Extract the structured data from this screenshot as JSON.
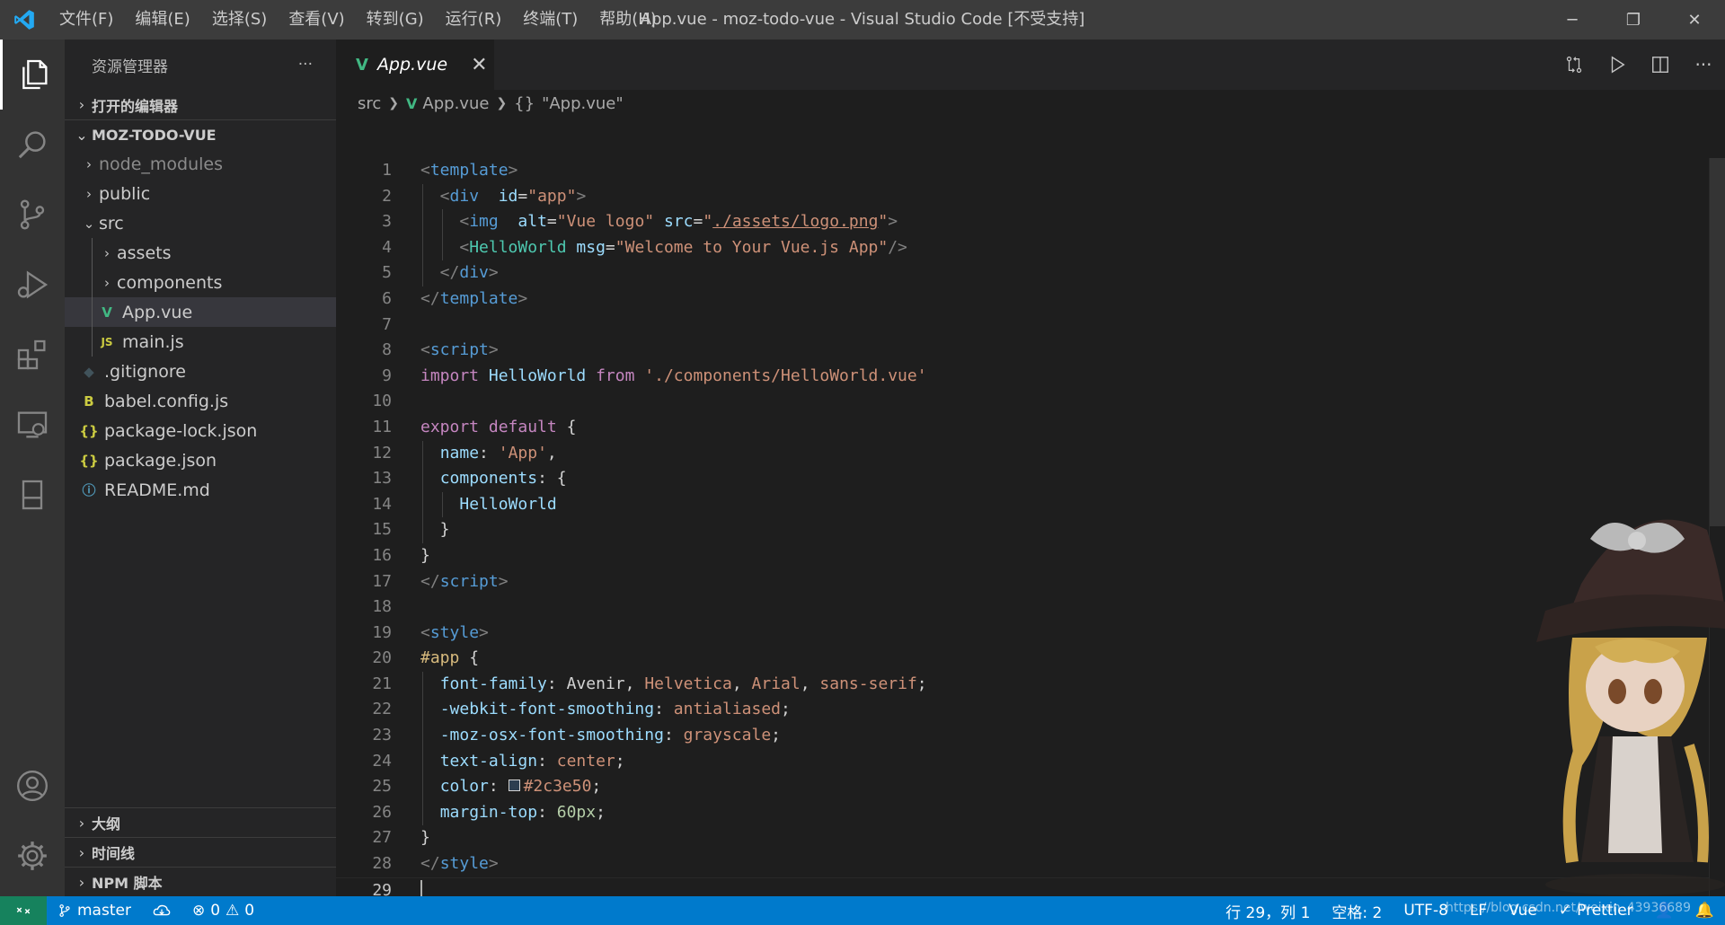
{
  "window": {
    "title": "App.vue - moz-todo-vue - Visual Studio Code [不受支持]",
    "menu": [
      "文件(F)",
      "编辑(E)",
      "选择(S)",
      "查看(V)",
      "转到(G)",
      "运行(R)",
      "终端(T)",
      "帮助(H)"
    ],
    "controls": {
      "minimize": "─",
      "restore": "❐",
      "close": "✕"
    }
  },
  "activity_bar": {
    "items": [
      "files-icon",
      "search-icon",
      "source-control-icon",
      "run-debug-icon",
      "extensions-icon",
      "remote-explorer-icon",
      "bookmark-icon"
    ],
    "bottom": [
      "account-icon",
      "settings-gear-icon"
    ],
    "active": "files-icon"
  },
  "sidebar": {
    "title": "资源管理器",
    "more": "···",
    "open_editors": "打开的编辑器",
    "project": "MOZ-TODO-VUE",
    "tree": [
      {
        "label": "node_modules",
        "type": "folder",
        "expanded": false,
        "depth": 1,
        "dim": true
      },
      {
        "label": "public",
        "type": "folder",
        "expanded": false,
        "depth": 1
      },
      {
        "label": "src",
        "type": "folder",
        "expanded": true,
        "depth": 1
      },
      {
        "label": "assets",
        "type": "folder",
        "expanded": false,
        "depth": 2
      },
      {
        "label": "components",
        "type": "folder",
        "expanded": false,
        "depth": 2
      },
      {
        "label": "App.vue",
        "type": "vue",
        "depth": 2,
        "selected": true
      },
      {
        "label": "main.js",
        "type": "js",
        "depth": 2
      },
      {
        "label": ".gitignore",
        "type": "git",
        "depth": 1
      },
      {
        "label": "babel.config.js",
        "type": "babel",
        "depth": 1
      },
      {
        "label": "package-lock.json",
        "type": "json",
        "depth": 1
      },
      {
        "label": "package.json",
        "type": "json",
        "depth": 1
      },
      {
        "label": "README.md",
        "type": "info",
        "depth": 1
      }
    ],
    "bottom_sections": [
      "大纲",
      "时间线",
      "NPM 脚本"
    ]
  },
  "editor": {
    "tab": {
      "label": "App.vue",
      "close": "✕"
    },
    "breadcrumb": {
      "folder": "src",
      "file": "App.vue",
      "symbol": "\"App.vue\"",
      "symbol_icon": "{}"
    },
    "current_line": 29,
    "lines": [
      [
        [
          "t-tag",
          "<"
        ],
        [
          "t-tagn",
          "template"
        ],
        [
          "t-tag",
          ">"
        ]
      ],
      [
        [
          "t-tag",
          "  <"
        ],
        [
          "t-tagn",
          "div"
        ],
        [
          "",
          "  "
        ],
        [
          "t-attr",
          "id"
        ],
        [
          "",
          "="
        ],
        [
          "t-str",
          "\"app\""
        ],
        [
          "t-tag",
          ">"
        ]
      ],
      [
        [
          "t-tag",
          "    <"
        ],
        [
          "t-tagn",
          "img"
        ],
        [
          "",
          "  "
        ],
        [
          "t-attr",
          "alt"
        ],
        [
          "",
          "="
        ],
        [
          "t-str",
          "\"Vue logo\""
        ],
        [
          "",
          " "
        ],
        [
          "t-attr",
          "src"
        ],
        [
          "",
          "="
        ],
        [
          "t-str",
          "\""
        ],
        [
          "t-str t-link",
          "./assets/logo.png"
        ],
        [
          "t-str",
          "\""
        ],
        [
          "t-tag",
          ">"
        ]
      ],
      [
        [
          "t-tag",
          "    <"
        ],
        [
          "t-comp",
          "HelloWorld"
        ],
        [
          "",
          " "
        ],
        [
          "t-attr",
          "msg"
        ],
        [
          "",
          "="
        ],
        [
          "t-str",
          "\"Welcome to Your Vue.js App\""
        ],
        [
          "t-tag",
          "/>"
        ]
      ],
      [
        [
          "t-tag",
          "  </"
        ],
        [
          "t-tagn",
          "div"
        ],
        [
          "t-tag",
          ">"
        ]
      ],
      [
        [
          "t-tag",
          "</"
        ],
        [
          "t-tagn",
          "template"
        ],
        [
          "t-tag",
          ">"
        ]
      ],
      [],
      [
        [
          "t-tag",
          "<"
        ],
        [
          "t-tagn",
          "script"
        ],
        [
          "t-tag",
          ">"
        ]
      ],
      [
        [
          "t-kw",
          "import"
        ],
        [
          "",
          " "
        ],
        [
          "t-attr",
          "HelloWorld"
        ],
        [
          "",
          " "
        ],
        [
          "t-kw",
          "from"
        ],
        [
          "",
          " "
        ],
        [
          "t-str",
          "'./components/HelloWorld.vue'"
        ]
      ],
      [],
      [
        [
          "t-kw",
          "export"
        ],
        [
          "",
          " "
        ],
        [
          "t-kw",
          "default"
        ],
        [
          "",
          " {"
        ]
      ],
      [
        [
          "",
          "  "
        ],
        [
          "t-attr",
          "name"
        ],
        [
          "",
          ": "
        ],
        [
          "t-str",
          "'App'"
        ],
        [
          "",
          ","
        ]
      ],
      [
        [
          "",
          "  "
        ],
        [
          "t-attr",
          "components"
        ],
        [
          "",
          ": {"
        ]
      ],
      [
        [
          "",
          "    "
        ],
        [
          "t-attr",
          "HelloWorld"
        ]
      ],
      [
        [
          "",
          "  }"
        ]
      ],
      [
        [
          "",
          "}"
        ]
      ],
      [
        [
          "t-tag",
          "</"
        ],
        [
          "t-tagn",
          "script"
        ],
        [
          "t-tag",
          ">"
        ]
      ],
      [],
      [
        [
          "t-tag",
          "<"
        ],
        [
          "t-tagn",
          "style"
        ],
        [
          "t-tag",
          ">"
        ]
      ],
      [
        [
          "t-sel",
          "#app"
        ],
        [
          "",
          " {"
        ]
      ],
      [
        [
          "",
          "  "
        ],
        [
          "t-prop",
          "font-family"
        ],
        [
          "",
          ": "
        ],
        [
          "",
          "Avenir"
        ],
        [
          "",
          ", "
        ],
        [
          "t-val",
          "Helvetica"
        ],
        [
          "",
          ", "
        ],
        [
          "t-val",
          "Arial"
        ],
        [
          "",
          ", "
        ],
        [
          "t-val",
          "sans-serif"
        ],
        [
          "",
          ";"
        ]
      ],
      [
        [
          "",
          "  "
        ],
        [
          "t-prop",
          "-webkit-font-smoothing"
        ],
        [
          "",
          ": "
        ],
        [
          "t-val",
          "antialiased"
        ],
        [
          "",
          ";"
        ]
      ],
      [
        [
          "",
          "  "
        ],
        [
          "t-prop",
          "-moz-osx-font-smoothing"
        ],
        [
          "",
          ": "
        ],
        [
          "t-val",
          "grayscale"
        ],
        [
          "",
          ";"
        ]
      ],
      [
        [
          "",
          "  "
        ],
        [
          "t-prop",
          "text-align"
        ],
        [
          "",
          ": "
        ],
        [
          "t-val",
          "center"
        ],
        [
          "",
          ";"
        ]
      ],
      [
        [
          "",
          "  "
        ],
        [
          "t-prop",
          "color"
        ],
        [
          "",
          ": "
        ],
        [
          "swatch",
          ""
        ],
        [
          "t-val",
          "#2c3e50"
        ],
        [
          "",
          ";"
        ]
      ],
      [
        [
          "",
          "  "
        ],
        [
          "t-prop",
          "margin-top"
        ],
        [
          "",
          ": "
        ],
        [
          "t-num",
          "60px"
        ],
        [
          "",
          ";"
        ]
      ],
      [
        [
          "",
          "}"
        ]
      ],
      [
        [
          "t-tag",
          "</"
        ],
        [
          "t-tagn",
          "style"
        ],
        [
          "t-tag",
          ">"
        ]
      ],
      [
        [
          "cursor",
          ""
        ]
      ]
    ]
  },
  "status_bar": {
    "branch": "master",
    "errors": "0",
    "warnings": "0",
    "position": "行 29，列 1",
    "spaces": "空格: 2",
    "encoding": "UTF-8",
    "eol": "LF",
    "language": "Vue",
    "formatter": "Prettier",
    "watermark": "https://blog.csdn.net/weixin_43936689"
  },
  "colors": {
    "titlebar": "#3c3c3c",
    "activitybar": "#333333",
    "sidebar": "#252526",
    "editor": "#1e1e1e",
    "statusbar": "#007acc",
    "vue_green": "#41b883"
  }
}
